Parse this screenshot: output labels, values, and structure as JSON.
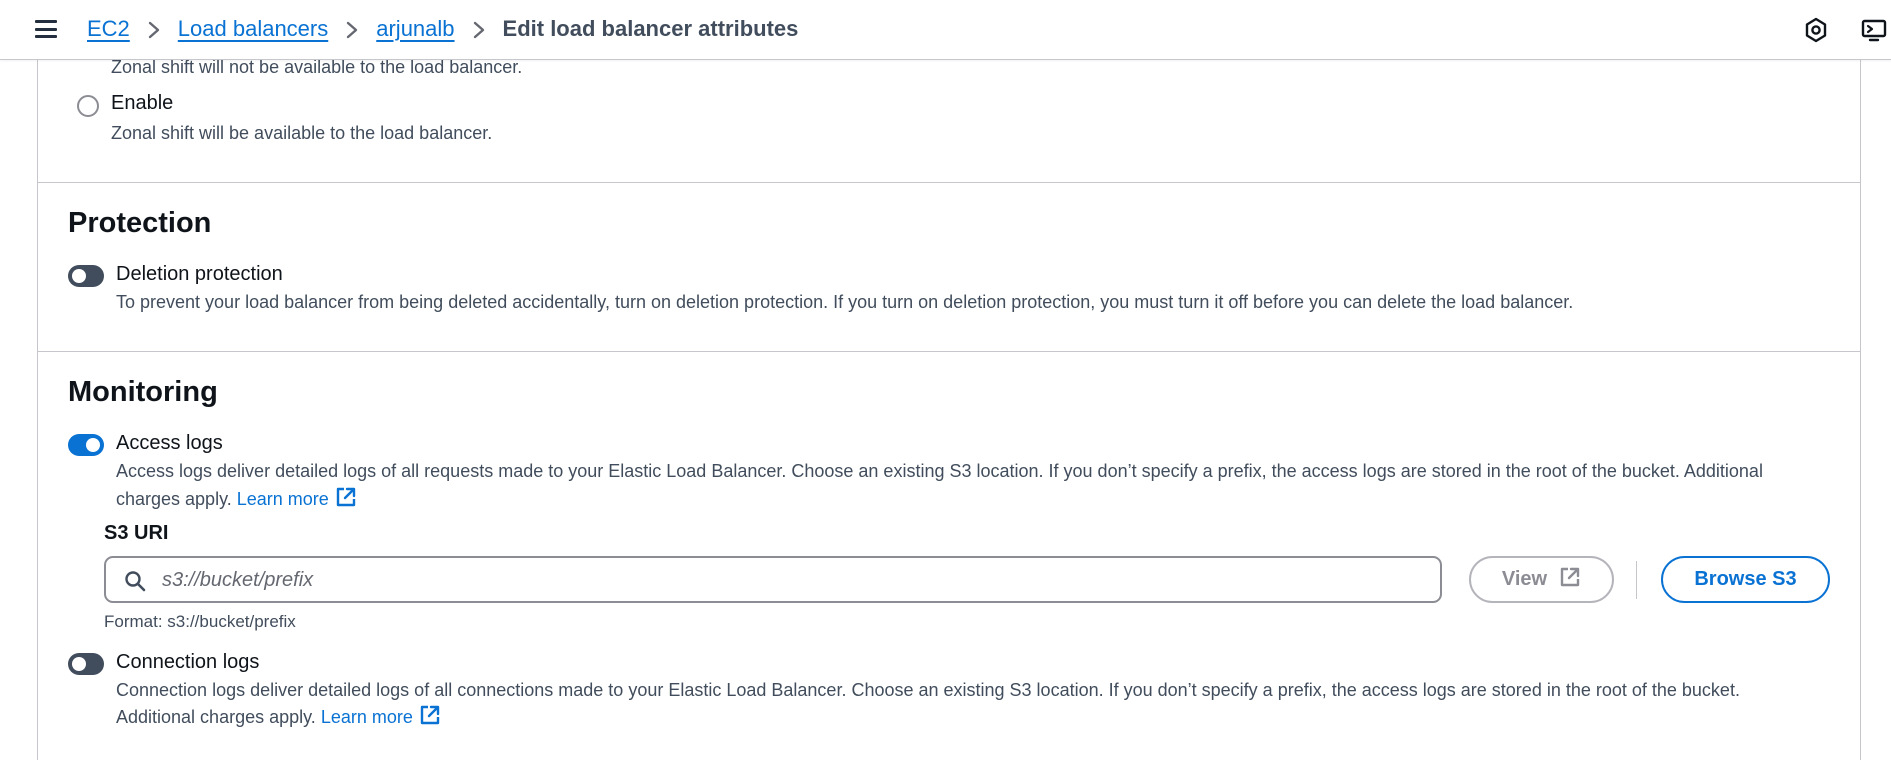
{
  "header": {
    "breadcrumbs": [
      {
        "label": "EC2",
        "link": true
      },
      {
        "label": "Load balancers",
        "link": true
      },
      {
        "label": "arjunalb",
        "link": true
      },
      {
        "label": "Edit load balancer attributes",
        "link": false
      }
    ],
    "icons": [
      "menu-icon",
      "chevron-right-icon",
      "notifications-icon",
      "console-toolbar-icon"
    ]
  },
  "zonal_shift": {
    "disable_description": "Zonal shift will not be available to the load balancer.",
    "enable_label": "Enable",
    "enable_description": "Zonal shift will be available to the load balancer."
  },
  "protection": {
    "title": "Protection",
    "deletion_label": "Deletion protection",
    "deletion_enabled": false,
    "deletion_description": "To prevent your load balancer from being deleted accidentally, turn on deletion protection. If you turn on deletion protection, you must turn it off before you can delete the load balancer."
  },
  "monitoring": {
    "title": "Monitoring",
    "access_logs": {
      "label": "Access logs",
      "enabled": true,
      "description_line1": "Access logs deliver detailed logs of all requests made to your Elastic Load Balancer. Choose an existing S3 location. If you don’t specify a prefix, the access logs are stored in the root of the bucket. Additional",
      "description_line2": "charges apply.",
      "learn_more": "Learn more"
    },
    "s3_uri": {
      "label": "S3 URI",
      "placeholder": "s3://bucket/prefix",
      "value": "",
      "format_hint": "Format: s3://bucket/prefix",
      "view_button": "View",
      "browse_button": "Browse S3"
    },
    "connection_logs": {
      "label": "Connection logs",
      "enabled": false,
      "description_line1": "Connection logs deliver detailed logs of all connections made to your Elastic Load Balancer. Choose an existing S3 location. If you don’t specify a prefix, the access logs are stored in the root of the bucket.",
      "description_line2": "Additional charges apply.",
      "learn_more": "Learn more"
    }
  },
  "colors": {
    "link": "#0972d3",
    "toggle_on": "#0972d3",
    "toggle_off": "#414d5c",
    "text_primary": "#0f141a",
    "text_secondary": "#414d5c",
    "border": "#c6c6cd"
  }
}
